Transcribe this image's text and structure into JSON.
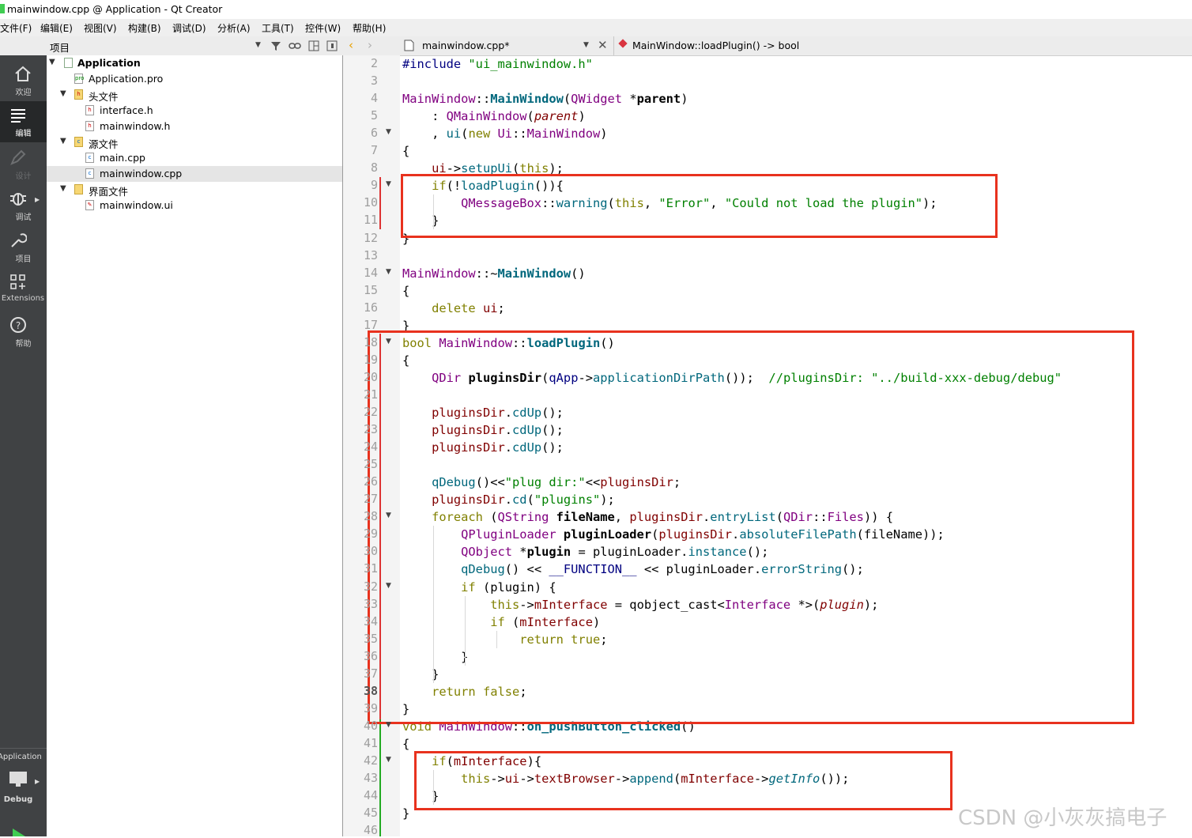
{
  "window": {
    "title": "mainwindow.cpp @ Application - Qt Creator"
  },
  "menu": [
    "文件(F)",
    "编辑(E)",
    "视图(V)",
    "构建(B)",
    "调试(D)",
    "分析(A)",
    "工具(T)",
    "控件(W)",
    "帮助(H)"
  ],
  "toolbar": {
    "panel_title": "项目",
    "file_tab": "mainwindow.cpp*",
    "function_selector": "MainWindow::loadPlugin() -> bool"
  },
  "modes": [
    {
      "label": "欢迎",
      "icon": "home-icon"
    },
    {
      "label": "编辑",
      "icon": "edit-icon"
    },
    {
      "label": "设计",
      "icon": "design-icon"
    },
    {
      "label": "调试",
      "icon": "debug-bug-icon"
    },
    {
      "label": "项目",
      "icon": "wrench-icon"
    },
    {
      "label": "Extensions",
      "icon": "extensions-icon"
    },
    {
      "label": "帮助",
      "icon": "help-icon"
    }
  ],
  "kit": {
    "project": "Application",
    "build": "Debug"
  },
  "tree": {
    "root": "Application",
    "pro_file": "Application.pro",
    "headers_folder": "头文件",
    "headers": [
      "interface.h",
      "mainwindow.h"
    ],
    "sources_folder": "源文件",
    "sources": [
      "main.cpp",
      "mainwindow.cpp"
    ],
    "forms_folder": "界面文件",
    "forms": [
      "mainwindow.ui"
    ]
  },
  "editor": {
    "current_line": 38,
    "line_numbers": [
      "2",
      "3",
      "4",
      "5",
      "6",
      "7",
      "8",
      "9",
      "10",
      "11",
      "12",
      "13",
      "14",
      "15",
      "16",
      "17",
      "18",
      "19",
      "20",
      "21",
      "22",
      "23",
      "24",
      "25",
      "26",
      "27",
      "28",
      "29",
      "30",
      "31",
      "32",
      "33",
      "34",
      "35",
      "36",
      "37",
      "38",
      "39",
      "40",
      "41",
      "42",
      "43",
      "44",
      "45",
      "46"
    ],
    "lines": [
      {
        "n": 2,
        "text": "#include \"ui_mainwindow.h\""
      },
      {
        "n": 3,
        "text": ""
      },
      {
        "n": 4,
        "text": "MainWindow::MainWindow(QWidget *parent)"
      },
      {
        "n": 5,
        "text": "    : QMainWindow(parent)"
      },
      {
        "n": 6,
        "text": "    , ui(new Ui::MainWindow)"
      },
      {
        "n": 7,
        "text": "{"
      },
      {
        "n": 8,
        "text": "    ui->setupUi(this);"
      },
      {
        "n": 9,
        "text": "    if(!loadPlugin()){"
      },
      {
        "n": 10,
        "text": "        QMessageBox::warning(this, \"Error\", \"Could not load the plugin\");"
      },
      {
        "n": 11,
        "text": "    }"
      },
      {
        "n": 12,
        "text": "}"
      },
      {
        "n": 13,
        "text": ""
      },
      {
        "n": 14,
        "text": "MainWindow::~MainWindow()"
      },
      {
        "n": 15,
        "text": "{"
      },
      {
        "n": 16,
        "text": "    delete ui;"
      },
      {
        "n": 17,
        "text": "}"
      },
      {
        "n": 18,
        "text": "bool MainWindow::loadPlugin()"
      },
      {
        "n": 19,
        "text": "{"
      },
      {
        "n": 20,
        "text": "    QDir pluginsDir(qApp->applicationDirPath());  //pluginsDir: \"../build-xxx-debug/debug\""
      },
      {
        "n": 21,
        "text": ""
      },
      {
        "n": 22,
        "text": "    pluginsDir.cdUp();"
      },
      {
        "n": 23,
        "text": "    pluginsDir.cdUp();"
      },
      {
        "n": 24,
        "text": "    pluginsDir.cdUp();"
      },
      {
        "n": 25,
        "text": ""
      },
      {
        "n": 26,
        "text": "    qDebug()<<\"plug dir:\"<<pluginsDir;"
      },
      {
        "n": 27,
        "text": "    pluginsDir.cd(\"plugins\");"
      },
      {
        "n": 28,
        "text": "    foreach (QString fileName, pluginsDir.entryList(QDir::Files)) {"
      },
      {
        "n": 29,
        "text": "        QPluginLoader pluginLoader(pluginsDir.absoluteFilePath(fileName));"
      },
      {
        "n": 30,
        "text": "        QObject *plugin = pluginLoader.instance();"
      },
      {
        "n": 31,
        "text": "        qDebug() << __FUNCTION__ << pluginLoader.errorString();"
      },
      {
        "n": 32,
        "text": "        if (plugin) {"
      },
      {
        "n": 33,
        "text": "            this->mInterface = qobject_cast<Interface *>(plugin);"
      },
      {
        "n": 34,
        "text": "            if (mInterface)"
      },
      {
        "n": 35,
        "text": "                return true;"
      },
      {
        "n": 36,
        "text": "        }"
      },
      {
        "n": 37,
        "text": "    }"
      },
      {
        "n": 38,
        "text": "    return false;"
      },
      {
        "n": 39,
        "text": "}"
      },
      {
        "n": 40,
        "text": "void MainWindow::on_pushButton_clicked()"
      },
      {
        "n": 41,
        "text": "{"
      },
      {
        "n": 42,
        "text": "    if(mInterface){"
      },
      {
        "n": 43,
        "text": "        this->ui->textBrowser->append(mInterface->getInfo());"
      },
      {
        "n": 44,
        "text": "    }"
      },
      {
        "n": 45,
        "text": "}"
      },
      {
        "n": 46,
        "text": ""
      }
    ]
  },
  "colors": {
    "keyword": "#808000",
    "type": "#800080",
    "function": "#00677c",
    "string": "#008000",
    "comment": "#008000",
    "macro": "#000080",
    "member": "#800000",
    "annotation_box": "#e8321e",
    "sidebar": "#404244"
  },
  "watermark": "CSDN @小灰灰搞电子"
}
